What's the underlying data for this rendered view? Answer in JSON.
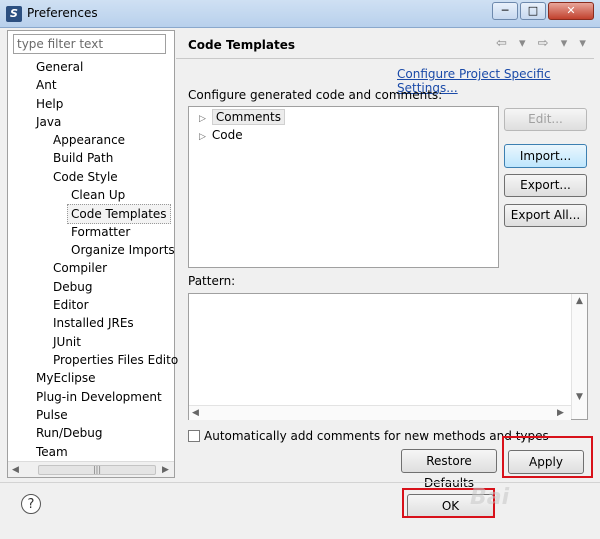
{
  "window": {
    "title": "Preferences",
    "controls": {
      "minimize": "─",
      "maximize": "□",
      "close": "✕"
    }
  },
  "filter": {
    "placeholder": "type filter text"
  },
  "tree": [
    {
      "label": "General"
    },
    {
      "label": "Ant"
    },
    {
      "label": "Help"
    },
    {
      "label": "Java"
    },
    {
      "label": "Appearance"
    },
    {
      "label": "Build Path"
    },
    {
      "label": "Code Style"
    },
    {
      "label": "Clean Up"
    },
    {
      "label": "Code Templates",
      "selected": true
    },
    {
      "label": "Formatter"
    },
    {
      "label": "Organize Imports"
    },
    {
      "label": "Compiler"
    },
    {
      "label": "Debug"
    },
    {
      "label": "Editor"
    },
    {
      "label": "Installed JREs"
    },
    {
      "label": "JUnit"
    },
    {
      "label": "Properties Files Edito"
    },
    {
      "label": "MyEclipse"
    },
    {
      "label": "Plug-in Development"
    },
    {
      "label": "Pulse"
    },
    {
      "label": "Run/Debug"
    },
    {
      "label": "Team"
    }
  ],
  "page": {
    "title": "Code Templates",
    "nav_arrows": "⇦ ▾ ⇨ ▾ ▾",
    "config_link": "Configure Project Specific Settings...",
    "config_label": "Configure generated code and comments:",
    "template_nodes": [
      "Comments",
      "Code"
    ],
    "buttons": {
      "edit": "Edit...",
      "import": "Import...",
      "export": "Export...",
      "export_all": "Export All..."
    },
    "pattern_label": "Pattern:",
    "auto_comment_label": "Automatically add comments for new methods and types",
    "restore_defaults": "Restore Defaults",
    "apply": "Apply"
  },
  "footer": {
    "help": "?",
    "ok": "OK"
  },
  "colors": {
    "highlight_box": "#d8111a",
    "link": "#1a4aa8"
  }
}
